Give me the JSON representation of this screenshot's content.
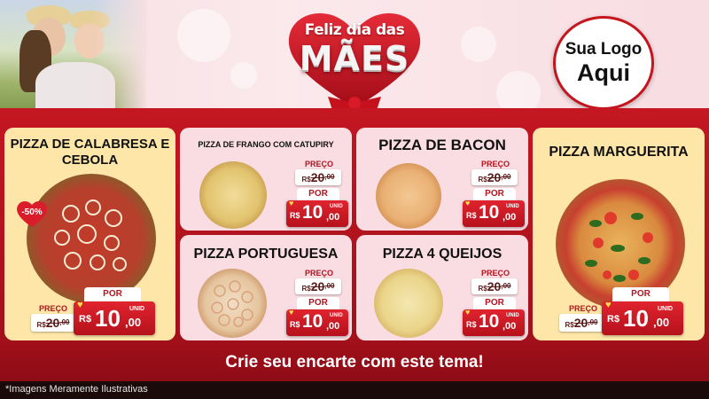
{
  "header": {
    "title_line1": "Feliz dia das",
    "title_line2": "MÃES",
    "logo_line1": "Sua Logo",
    "logo_line2": "Aqui"
  },
  "products": [
    {
      "name": "PIZZA DE CALABRESA E CEBOLA",
      "discount": "-50%",
      "old_price_label": "PREÇO",
      "currency": "R$",
      "old_price": "20",
      "old_cents": ",00",
      "new_price_label": "POR",
      "new_price": "10",
      "new_cents": ",00",
      "unit": "UNID"
    },
    {
      "name": "PIZZA DE FRANGO COM CATUPIRY",
      "old_price_label": "PREÇO",
      "currency": "R$",
      "old_price": "20",
      "old_cents": ",00",
      "new_price_label": "POR",
      "new_price": "10",
      "new_cents": ",00",
      "unit": "UNID"
    },
    {
      "name": "PIZZA DE BACON",
      "old_price_label": "PREÇO",
      "currency": "R$",
      "old_price": "20",
      "old_cents": ",00",
      "new_price_label": "POR",
      "new_price": "10",
      "new_cents": ",00",
      "unit": "UNID"
    },
    {
      "name": "PIZZA MARGUERITA",
      "old_price_label": "PREÇO",
      "currency": "R$",
      "old_price": "20",
      "old_cents": ",00",
      "new_price_label": "POR",
      "new_price": "10",
      "new_cents": ",00",
      "unit": "UNID"
    },
    {
      "name": "PIZZA PORTUGUESA",
      "old_price_label": "PREÇO",
      "currency": "R$",
      "old_price": "20",
      "old_cents": ",00",
      "new_price_label": "POR",
      "new_price": "10",
      "new_cents": ",00",
      "unit": "UNID"
    },
    {
      "name": "PIZZA 4 QUEIJOS",
      "old_price_label": "PREÇO",
      "currency": "R$",
      "old_price": "20",
      "old_cents": ",00",
      "new_price_label": "POR",
      "new_price": "10",
      "new_cents": ",00",
      "unit": "UNID"
    }
  ],
  "footer": {
    "cta": "Crie seu encarte com este tema!",
    "disclaimer": "*Imagens Meramente Ilustrativas"
  },
  "colors": {
    "brand_red": "#c41722",
    "card_yellow": "#fde6a8",
    "card_pink": "#f9dde2",
    "header_pink": "#f6dfe3"
  }
}
